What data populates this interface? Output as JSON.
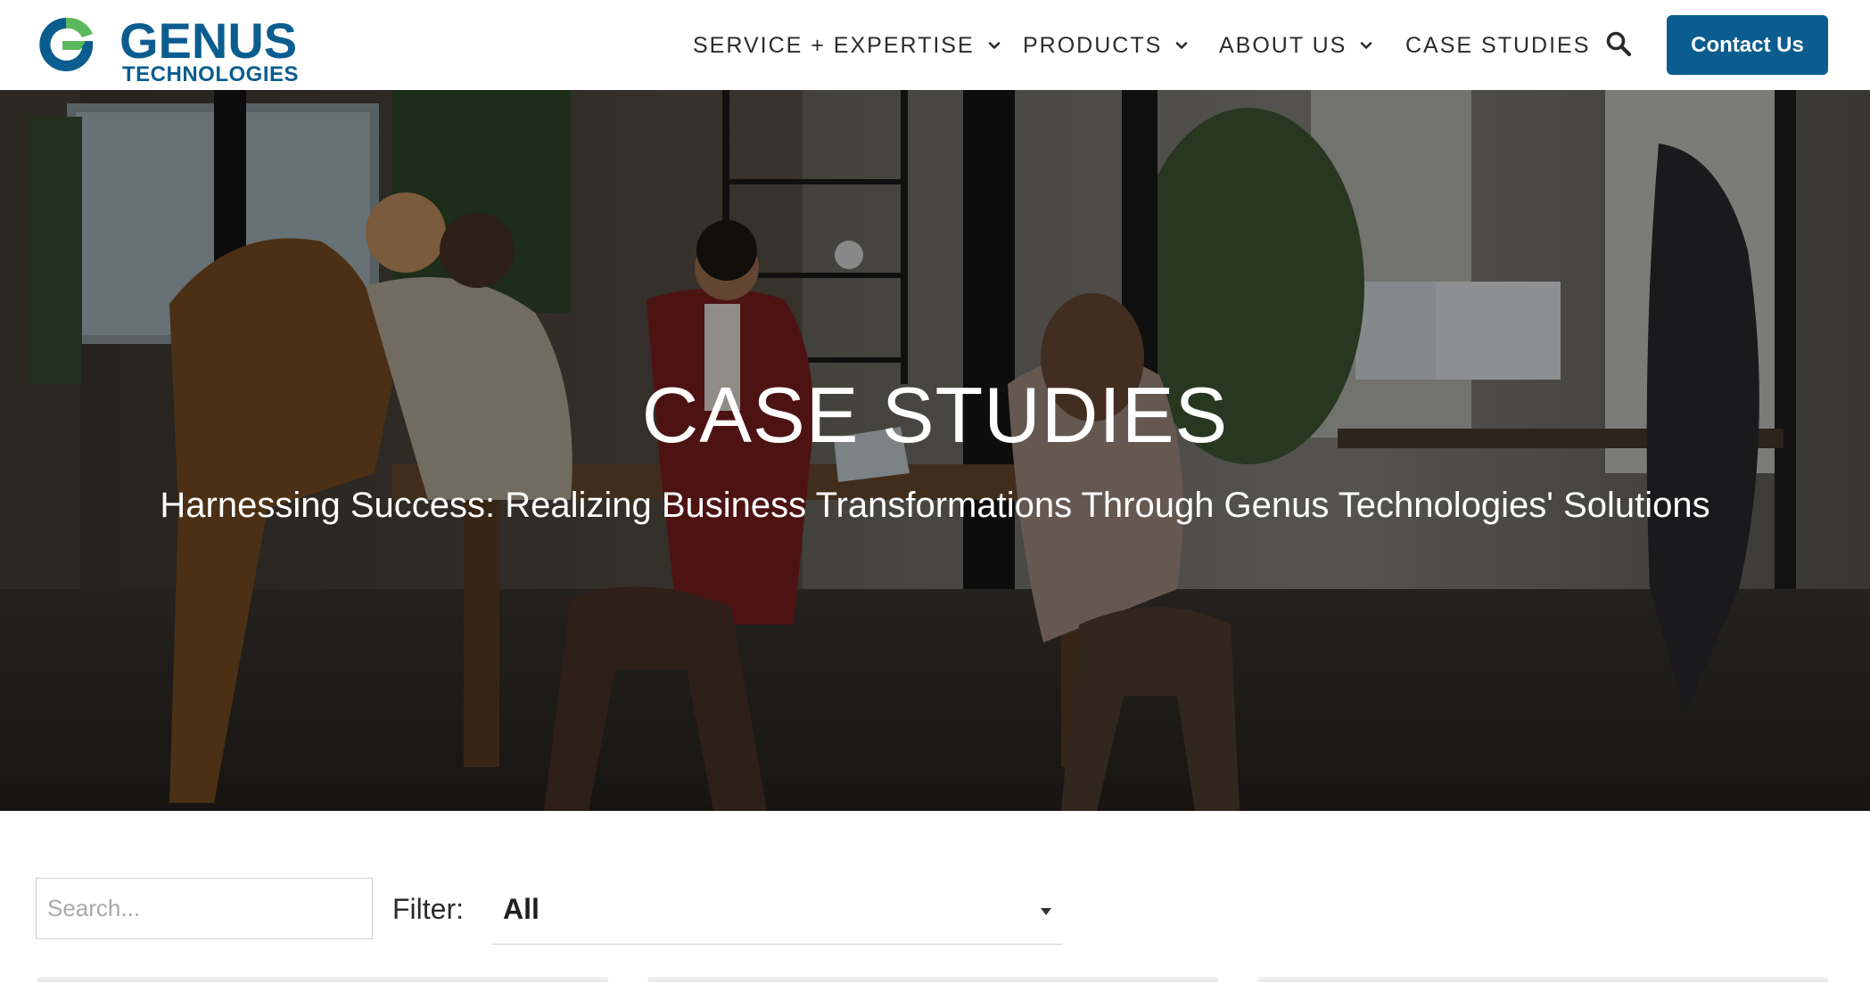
{
  "brand": {
    "name": "GENUS",
    "tagline": "TECHNOLOGIES",
    "primary_color": "#0c5d8f",
    "accent_color": "#5cb85c"
  },
  "nav": {
    "items": [
      {
        "label": "SERVICE + EXPERTISE",
        "has_dropdown": true
      },
      {
        "label": "PRODUCTS",
        "has_dropdown": true
      },
      {
        "label": "ABOUT US",
        "has_dropdown": true
      },
      {
        "label": "CASE STUDIES",
        "has_dropdown": false
      }
    ],
    "search_icon": "search-icon",
    "contact_label": "Contact Us"
  },
  "hero": {
    "title": "CASE STUDIES",
    "subtitle": "Harnessing Success: Realizing Business Transformations Through Genus Technologies' Solutions"
  },
  "filters": {
    "search_placeholder": "Search...",
    "filter_label": "Filter:",
    "selected": "All"
  }
}
